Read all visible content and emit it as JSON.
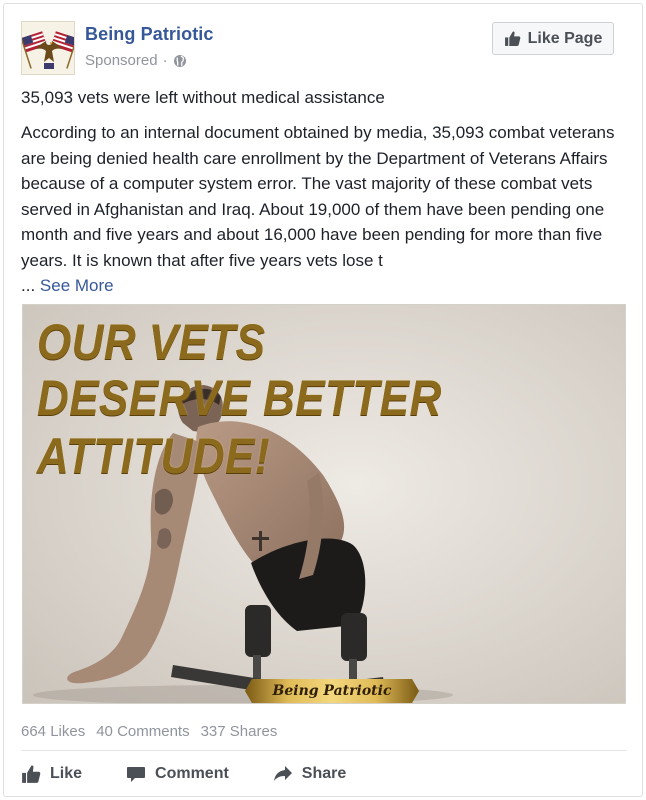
{
  "post": {
    "page_name": "Being Patriotic",
    "sponsored_label": "Sponsored",
    "meta_separator": "·",
    "like_page_label": "Like Page",
    "headline": "35,093 vets were left without medical assistance",
    "body": "According to an internal document obtained by media, 35,093 combat veterans are being denied health care enrollment by the Department of Veterans Affairs because of a computer system error. The vast majority of these combat vets served in Afghanistan and Iraq. About 19,000 of them have been pending one month and five years and about 16,000 have been pending for more than five years. It is known that after five years vets lose t",
    "see_more_prefix": "...",
    "see_more_label": "See More"
  },
  "image": {
    "overlay_line_1": "OUR VETS",
    "overlay_line_2": "DESERVE BETTER ATTITUDE!",
    "watermark": "Being Patriotic"
  },
  "stats": {
    "likes": "664 Likes",
    "comments": "40 Comments",
    "shares": "337 Shares"
  },
  "actions": {
    "like": "Like",
    "comment": "Comment",
    "share": "Share"
  },
  "colors": {
    "link": "#365899",
    "meta": "#90949c",
    "text": "#1d2129",
    "overlay_gold": "#8c6a1d"
  },
  "icons": {
    "avatar": "eagle-flags-logo",
    "globe": "globe-icon",
    "like_page": "thumbs-up-icon",
    "like": "thumbs-up-icon",
    "comment": "speech-bubble-icon",
    "share": "share-arrow-icon"
  }
}
